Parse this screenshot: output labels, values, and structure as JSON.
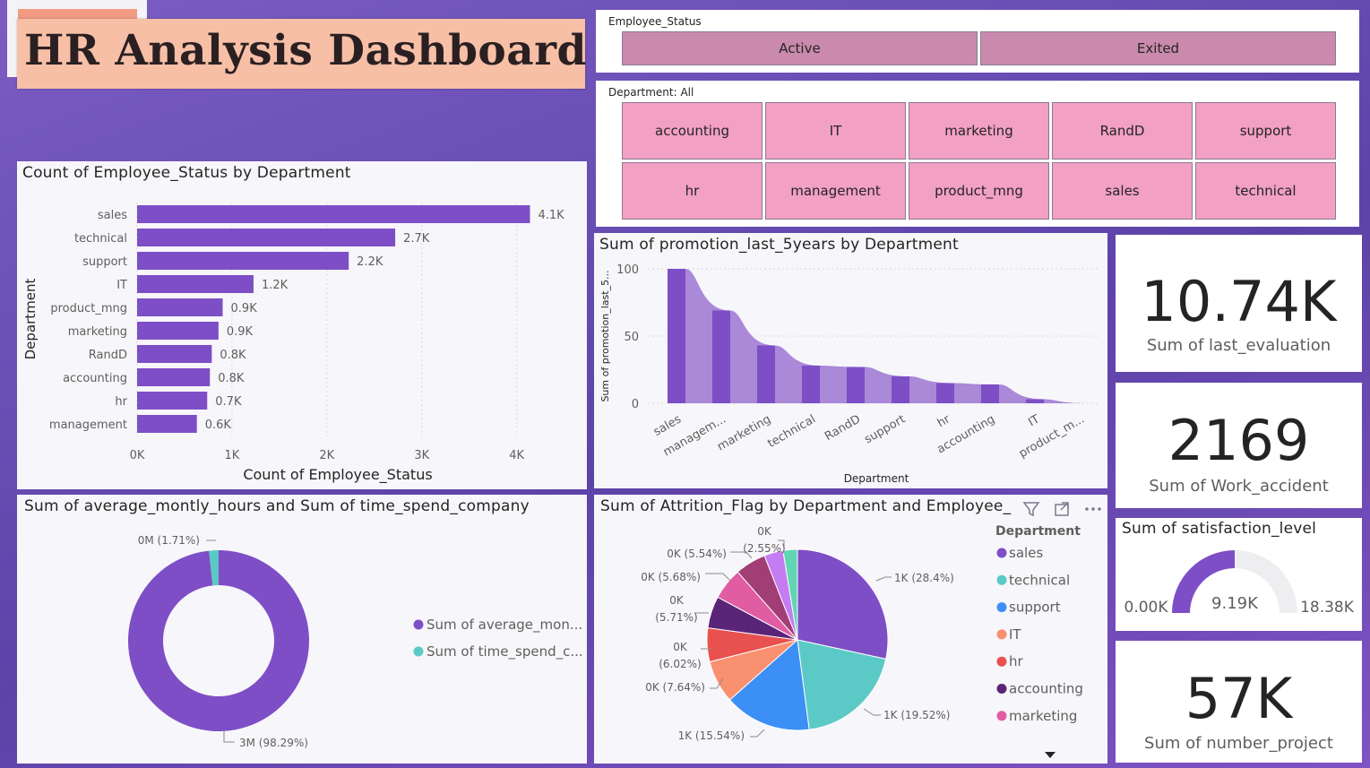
{
  "header": {
    "title": "HR Analysis Dashboard"
  },
  "status_slicer": {
    "caption": "Employee_Status",
    "options": [
      "Active",
      "Exited"
    ]
  },
  "dept_slicer": {
    "caption": "Department: All",
    "options": [
      "accounting",
      "IT",
      "marketing",
      "RandD",
      "support",
      "hr",
      "management",
      "product_mng",
      "sales",
      "technical"
    ]
  },
  "bar_chart": {
    "title": "Count of Employee_Status by Department"
  },
  "area_chart": {
    "title": "Sum of promotion_last_5years by Department"
  },
  "donut_chart": {
    "title": "Sum of average_montly_hours and Sum of time_spend_company"
  },
  "pie_chart": {
    "title": "Sum of Attrition_Flag by Department and Employee_Status",
    "title_visible": "Sum of Attrition_Flag by Department and Employee_"
  },
  "cards": [
    {
      "value": "10.74K",
      "label": "Sum of last_evaluation"
    },
    {
      "value": "2169",
      "label": "Sum of Work_accident"
    },
    {
      "value": "57K",
      "label": "Sum of number_project"
    }
  ],
  "gauge": {
    "title": "Sum of satisfaction_level",
    "min": "0.00K",
    "value": "9.19K",
    "max": "18.38K",
    "value_num": 9.19,
    "max_num": 18.38
  },
  "colors": {
    "primary": "#7e4ec6",
    "teal": "#5bcac6",
    "slicer_status": "#c98aad",
    "slicer_dept": "#f2a0c4",
    "header_bg": "#f8bfa7"
  },
  "chart_data": [
    {
      "type": "bar",
      "title": "Count of Employee_Status by Department",
      "xlabel": "Count of Employee_Status",
      "ylabel": "Department",
      "categories": [
        "sales",
        "technical",
        "support",
        "IT",
        "product_mng",
        "marketing",
        "RandD",
        "accounting",
        "hr",
        "management"
      ],
      "values": [
        4140,
        2720,
        2230,
        1227,
        902,
        858,
        787,
        767,
        739,
        630
      ],
      "data_labels": [
        "4.1K",
        "2.7K",
        "2.2K",
        "1.2K",
        "0.9K",
        "0.9K",
        "0.8K",
        "0.8K",
        "0.7K",
        "0.6K"
      ],
      "xlim": [
        0,
        4400
      ],
      "xticks": [
        "0K",
        "1K",
        "2K",
        "3K",
        "4K"
      ],
      "grid": true
    },
    {
      "type": "area",
      "title": "Sum of promotion_last_5years by Department",
      "xlabel": "Department",
      "ylabel": "Sum of promotion_last_5...",
      "categories": [
        "sales",
        "managem...",
        "marketing",
        "technical",
        "RandD",
        "support",
        "hr",
        "accounting",
        "IT",
        "product_m..."
      ],
      "values": [
        100,
        69,
        43,
        28,
        27,
        20,
        15,
        14,
        3,
        0
      ],
      "ylim": [
        0,
        100
      ],
      "yticks": [
        "0",
        "50",
        "100"
      ]
    },
    {
      "type": "pie",
      "subtype": "donut",
      "title": "Sum of average_montly_hours and Sum of time_spend_company",
      "slices": [
        {
          "name": "Sum of average_mon...",
          "label": "3M (98.29%)",
          "percent": 98.29,
          "color": "#7e4ec6"
        },
        {
          "name": "Sum of time_spend_c...",
          "label": "0M (1.71%)",
          "percent": 1.71,
          "color": "#5bcac6"
        }
      ]
    },
    {
      "type": "pie",
      "title": "Sum of Attrition_Flag by Department and Employee_Status",
      "legend_title": "Department",
      "legend": [
        {
          "name": "sales",
          "color": "#7e4ec6"
        },
        {
          "name": "technical",
          "color": "#5bcac6"
        },
        {
          "name": "support",
          "color": "#3c8ff5"
        },
        {
          "name": "IT",
          "color": "#f9906f"
        },
        {
          "name": "hr",
          "color": "#e8514e"
        },
        {
          "name": "accounting",
          "color": "#5a2579"
        },
        {
          "name": "marketing",
          "color": "#e05ca3"
        }
      ],
      "slices": [
        {
          "label": "1K (28.4%)",
          "percent": 28.4,
          "color": "#7e4ec6"
        },
        {
          "label": "1K (19.52%)",
          "percent": 19.52,
          "color": "#5bcac6"
        },
        {
          "label": "1K (15.54%)",
          "percent": 15.54,
          "color": "#3c8ff5"
        },
        {
          "label": "0K (7.64%)",
          "percent": 7.64,
          "color": "#f9906f"
        },
        {
          "label_lines": [
            "0K",
            "(6.02%)"
          ],
          "percent": 6.02,
          "color": "#e8514e"
        },
        {
          "label_lines": [
            "0K",
            "(5.71%)"
          ],
          "percent": 5.71,
          "color": "#5a2579"
        },
        {
          "label": "0K (5.68%)",
          "percent": 5.68,
          "color": "#e05ca3"
        },
        {
          "label": "0K (5.54%)",
          "percent": 5.54,
          "color": "#a13e76"
        },
        {
          "label": "",
          "percent": 3.4,
          "color": "#c57cf0"
        },
        {
          "label_lines": [
            "0K",
            "(2.55%)"
          ],
          "percent": 2.55,
          "color": "#62d6b4"
        }
      ]
    }
  ]
}
